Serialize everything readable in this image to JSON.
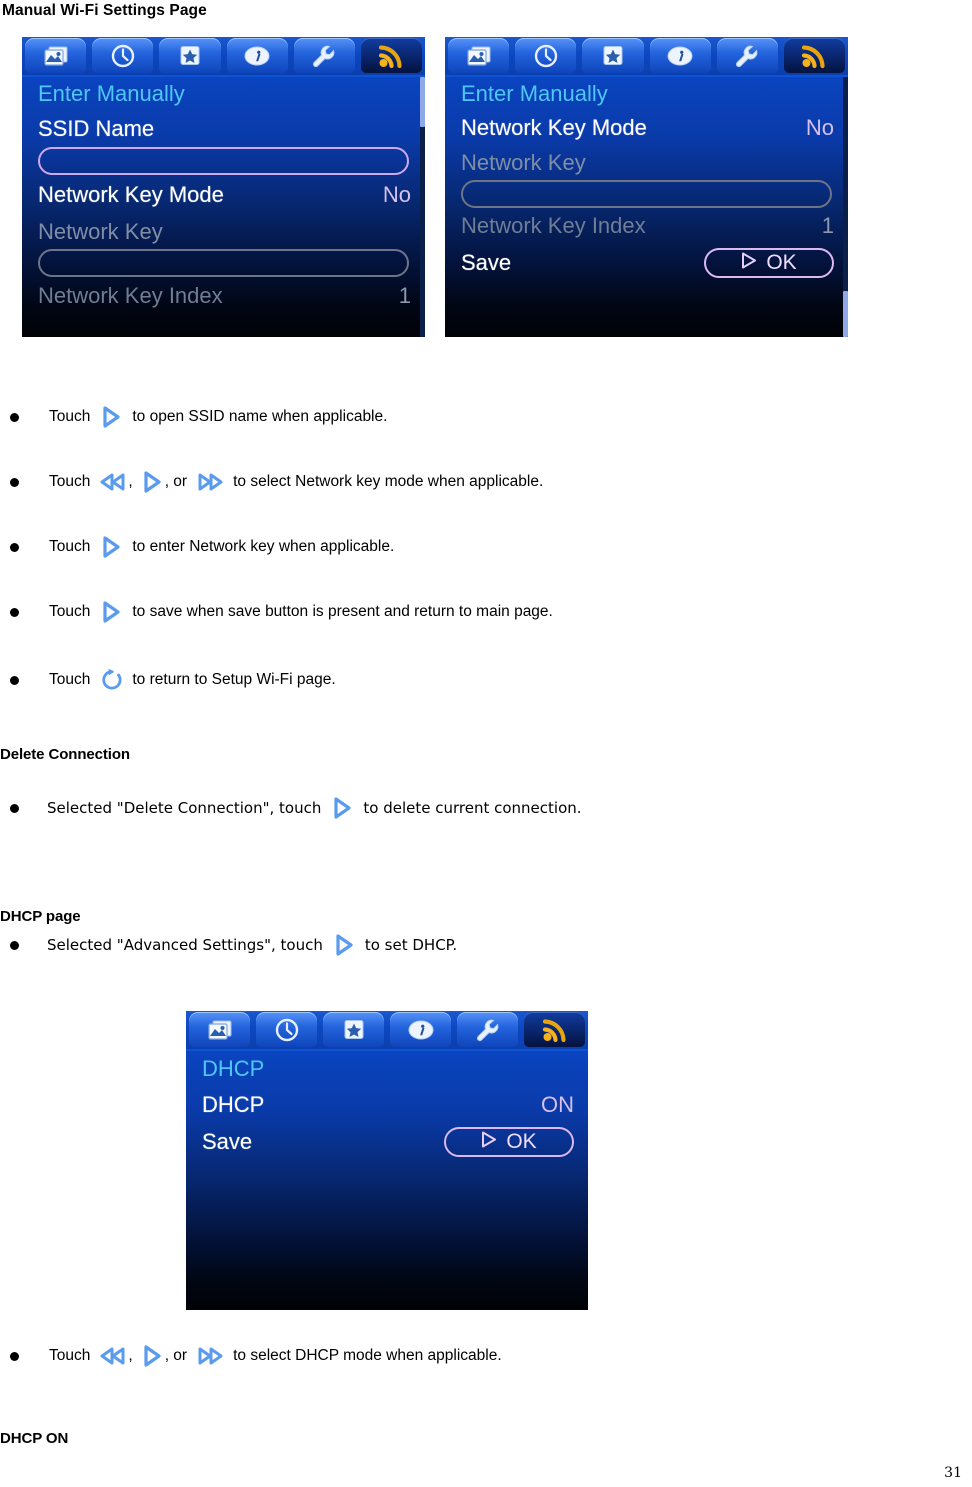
{
  "document": {
    "title": "Manual Wi-Fi Settings Page",
    "page_number": "31"
  },
  "toolbar_icons": [
    {
      "name": "photo-icon",
      "label": "Photo"
    },
    {
      "name": "clock-icon",
      "label": "Clock"
    },
    {
      "name": "star-icon",
      "label": "Favorites"
    },
    {
      "name": "info-icon",
      "label": "Info"
    },
    {
      "name": "wrench-icon",
      "label": "Settings"
    },
    {
      "name": "wifi-icon",
      "label": "Wi-Fi"
    }
  ],
  "screens": {
    "manual_1": {
      "title": "Enter Manually",
      "rows": [
        {
          "label": "SSID Name",
          "value": ""
        },
        {
          "label": "Network Key Mode",
          "value": "No"
        },
        {
          "label": "Network Key",
          "value": ""
        },
        {
          "label": "Network Key Index",
          "value": "1"
        }
      ]
    },
    "manual_2": {
      "title": "Enter Manually",
      "rows": [
        {
          "label": "Network Key Mode",
          "value": "No"
        },
        {
          "label": "Network Key",
          "value": ""
        },
        {
          "label": "Network Key Index",
          "value": "1"
        },
        {
          "label": "Save",
          "value": "OK"
        }
      ]
    },
    "dhcp": {
      "title": "DHCP",
      "rows": [
        {
          "label": "DHCP",
          "value": "ON"
        },
        {
          "label": "Save",
          "value": "OK"
        }
      ]
    }
  },
  "bullets": {
    "b1": {
      "touch": "Touch",
      "rest": "to open SSID name when applicable."
    },
    "b2": {
      "touch": "Touch",
      "comma": ",",
      "or": ", or",
      "rest": "to select Network key mode when applicable."
    },
    "b3": {
      "touch": "Touch",
      "rest": "to enter Network key when applicable."
    },
    "b4": {
      "touch": "Touch",
      "rest": "to save when save button is present and return to main page."
    },
    "b5": {
      "touch": "Touch",
      "rest": "to return to Setup Wi-Fi page."
    },
    "b6": {
      "pre": "Selected \"Delete Connection\", touch",
      "rest": "to delete current connection."
    },
    "b7": {
      "pre": "Selected \"Advanced Settings\", touch",
      "rest": "to set DHCP."
    },
    "b8": {
      "touch": "Touch",
      "comma": ",",
      "or": ", or",
      "rest": "to select DHCP mode when applicable."
    }
  },
  "headings": {
    "delete_connection": "Delete Connection",
    "dhcp_page": "DHCP page",
    "dhcp_on": "DHCP ON"
  },
  "colors": {
    "accent_blue": "#4a90e8",
    "screen_title": "#4fc7f5",
    "value_pink": "#d8c0ee",
    "wifi_orange": "#f2a81c"
  }
}
